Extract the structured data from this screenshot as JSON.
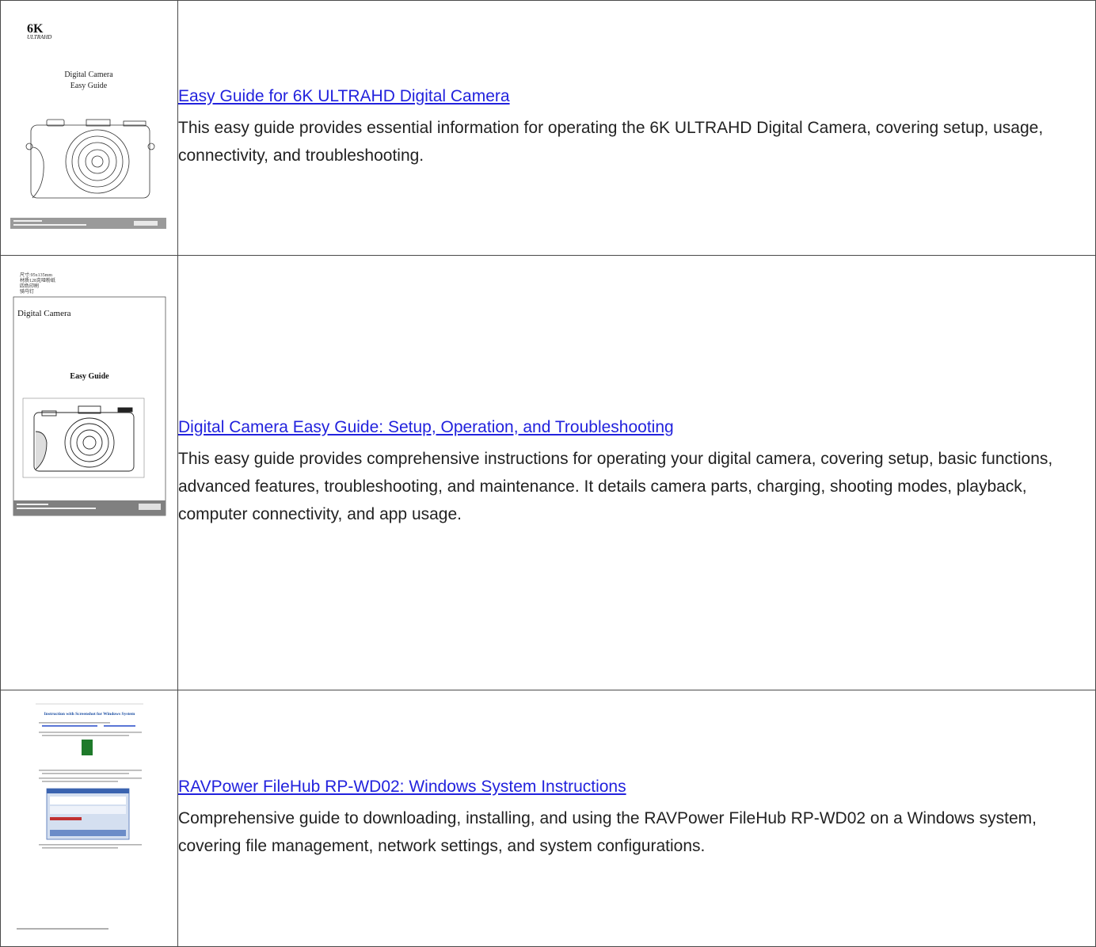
{
  "results": [
    {
      "title": "Easy Guide for 6K ULTRAHD Digital Camera",
      "description": "This easy guide provides essential information for operating the 6K ULTRAHD Digital Camera, covering setup, usage, connectivity, and troubleshooting.",
      "thumb": {
        "logo_main": "6K",
        "logo_sub": "ULTRAHD",
        "heading_line1": "Digital Camera",
        "heading_line2": "Easy Guide"
      }
    },
    {
      "title": "Digital Camera Easy Guide: Setup, Operation, and Troubleshooting",
      "description": "This easy guide provides comprehensive instructions for operating your digital camera, covering setup, basic functions, advanced features, troubleshooting, and maintenance. It details camera parts, charging, shooting modes, playback, computer connectivity, and app usage.",
      "thumb": {
        "spec_lines": [
          "尺寸:95x135mm",
          "材质128克哑粉纸",
          "四色印刷",
          "骑马钉"
        ],
        "heading": "Digital Camera",
        "subheading": "Easy Guide"
      }
    },
    {
      "title": "RAVPower FileHub RP-WD02: Windows System Instructions",
      "description": "Comprehensive guide to downloading, installing, and using the RAVPower FileHub RP-WD02 on a Windows system, covering file management, network settings, and system configurations.",
      "thumb": {
        "heading": "Instruction with Screenshot for Windows System"
      }
    }
  ]
}
